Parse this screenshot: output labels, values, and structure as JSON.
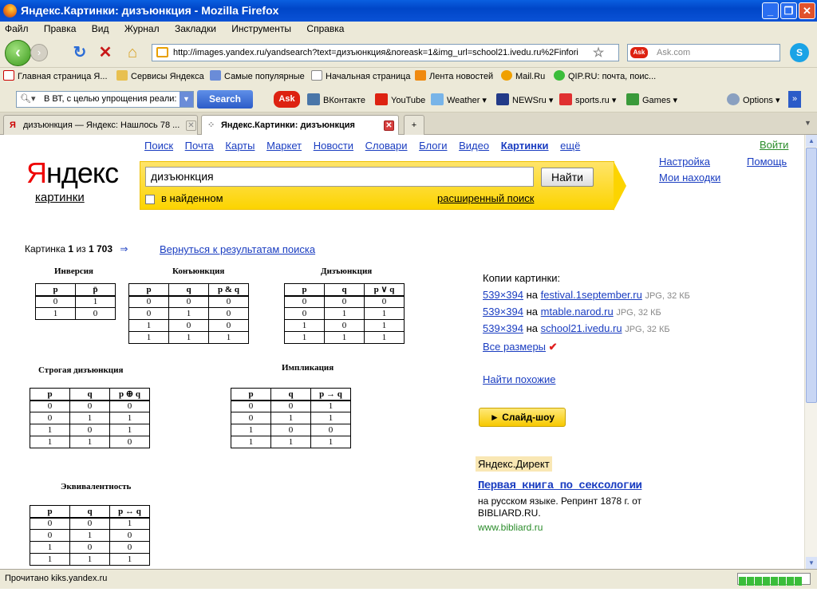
{
  "window": {
    "title": "Яндекс.Картинки: дизъюнкция - Mozilla Firefox"
  },
  "menu": [
    "Файл",
    "Правка",
    "Вид",
    "Журнал",
    "Закладки",
    "Инструменты",
    "Справка"
  ],
  "nav": {
    "url": "http://images.yandex.ru/yandsearch?text=дизъюнкция&noreask=1&img_url=school21.ivedu.ru%2Finfori",
    "ask_placeholder": "Ask.com"
  },
  "bookmarks": [
    "Главная страница Я...",
    "Сервисы Яндекса",
    "Самые популярные",
    "Начальная страница",
    "Лента новостей",
    "Mail.Ru",
    "QIP.RU: почта, поис..."
  ],
  "toolbar": {
    "search_text": "В ВТ, с целью упрощения реали:",
    "search_button": "Search",
    "items": [
      "ВКонтакте",
      "YouTube",
      "Weather",
      "NEWSru",
      "sports.ru",
      "Games",
      "Options"
    ]
  },
  "tabs": [
    {
      "label": "дизъюнкция — Яндекс: Нашлось 78 ..."
    },
    {
      "label": "Яндекс.Картинки: дизъюнкция"
    }
  ],
  "status": {
    "text": "Прочитано kiks.yandex.ru"
  },
  "yandex": {
    "nav": [
      "Поиск",
      "Почта",
      "Карты",
      "Маркет",
      "Новости",
      "Словари",
      "Блоги",
      "Видео",
      "Картинки",
      "ещё"
    ],
    "login": "Войти",
    "settings": "Настройка",
    "help": "Помощь",
    "finds": "Мои находки",
    "logo_first": "Я",
    "logo_rest": "ндекс",
    "logo_sub": "картинки",
    "query": "дизъюнкция",
    "find_button": "Найти",
    "in_found": "в найденном",
    "advanced": "расширенный поиск"
  },
  "result": {
    "counter_prefix": "Картинка ",
    "counter_current": "1",
    "counter_mid": " из ",
    "counter_total": "1 703",
    "counter_arrow": "⇒",
    "back_link": "Вернуться к результатам поиска",
    "copies_title": "Копии картинки:",
    "copies": [
      {
        "size": "539×394",
        "on": "на",
        "site": "festival.1september.ru",
        "meta": "JPG, 32 КБ"
      },
      {
        "size": "539×394",
        "on": "на",
        "site": "mtable.narod.ru",
        "meta": "JPG, 32 КБ"
      },
      {
        "size": "539×394",
        "on": "на",
        "site": "school21.ivedu.ru",
        "meta": "JPG, 32 КБ"
      }
    ],
    "all_sizes": "Все размеры",
    "all_sizes_mark": "✔",
    "similar": "Найти похожие",
    "slideshow": "► Слайд-шоу"
  },
  "ad": {
    "label": "Яндекс.Директ",
    "title": "Первая книга по сексологии",
    "text": "на русском языке. Репринт 1878 г. от BIBLIARD.RU.",
    "url": "www.bibliard.ru"
  },
  "image": {
    "titles": {
      "inv": "Инверсия",
      "conj": "Конъюнкция",
      "disj": "Дизъюнкция",
      "xor": "Строгая дизъюнкция",
      "impl": "Импликация",
      "eq": "Эквивалентность"
    },
    "inv": [
      [
        "p",
        "p̄"
      ],
      [
        "0",
        "1"
      ],
      [
        "1",
        "0"
      ]
    ],
    "conj": [
      [
        "p",
        "q",
        "p & q"
      ],
      [
        "0",
        "0",
        "0"
      ],
      [
        "0",
        "1",
        "0"
      ],
      [
        "1",
        "0",
        "0"
      ],
      [
        "1",
        "1",
        "1"
      ]
    ],
    "disj": [
      [
        "p",
        "q",
        "p ∨ q"
      ],
      [
        "0",
        "0",
        "0"
      ],
      [
        "0",
        "1",
        "1"
      ],
      [
        "1",
        "0",
        "1"
      ],
      [
        "1",
        "1",
        "1"
      ]
    ],
    "xor": [
      [
        "p",
        "q",
        "p ⊕ q"
      ],
      [
        "0",
        "0",
        "0"
      ],
      [
        "0",
        "1",
        "1"
      ],
      [
        "1",
        "0",
        "1"
      ],
      [
        "1",
        "1",
        "0"
      ]
    ],
    "impl": [
      [
        "p",
        "q",
        "p → q"
      ],
      [
        "0",
        "0",
        "1"
      ],
      [
        "0",
        "1",
        "1"
      ],
      [
        "1",
        "0",
        "0"
      ],
      [
        "1",
        "1",
        "1"
      ]
    ],
    "eq": [
      [
        "p",
        "q",
        "p ↔ q"
      ],
      [
        "0",
        "0",
        "1"
      ],
      [
        "0",
        "1",
        "0"
      ],
      [
        "1",
        "0",
        "0"
      ],
      [
        "1",
        "1",
        "1"
      ]
    ]
  }
}
